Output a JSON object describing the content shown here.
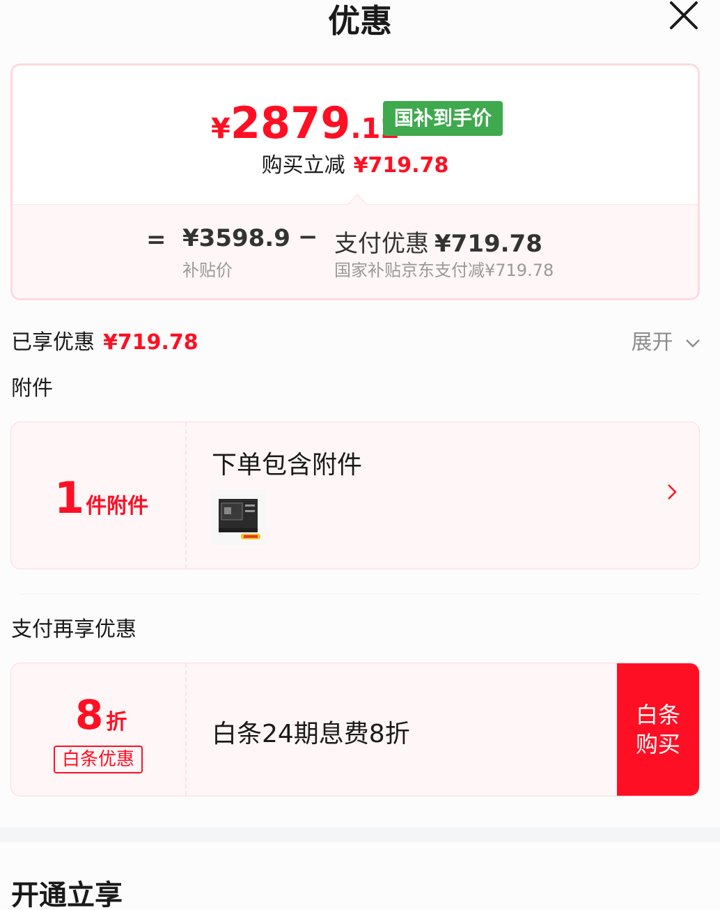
{
  "header": {
    "title": "优惠"
  },
  "price_card": {
    "currency": "¥",
    "final_price_int": "2879",
    "final_price_dec": ".12",
    "tag": "国补到手价",
    "reduce_label": "购买立减",
    "reduce_value": "¥719.78",
    "eq": "=",
    "subsidy_price": "¥3598.9",
    "subsidy_label": "补贴价",
    "minus": "−",
    "pay_discount_label": "支付优惠",
    "pay_discount_value": "¥719.78",
    "pay_discount_note": "国家补贴京东支付减¥719.78"
  },
  "enjoyed": {
    "label": "已享优惠",
    "value": "¥719.78",
    "expand": "展开"
  },
  "accessory_section": {
    "title": "附件",
    "count": "1",
    "count_unit": "件附件",
    "card_title": "下单包含附件"
  },
  "pay_section": {
    "title": "支付再享优惠",
    "discount": "8",
    "discount_unit": "折",
    "tag": "白条优惠",
    "desc": "白条24期息费8折",
    "button": "白条购买"
  },
  "bottom": {
    "title": "开通立享"
  },
  "colors": {
    "accent": "#ff0f23",
    "green_tag": "#3fa94d"
  }
}
